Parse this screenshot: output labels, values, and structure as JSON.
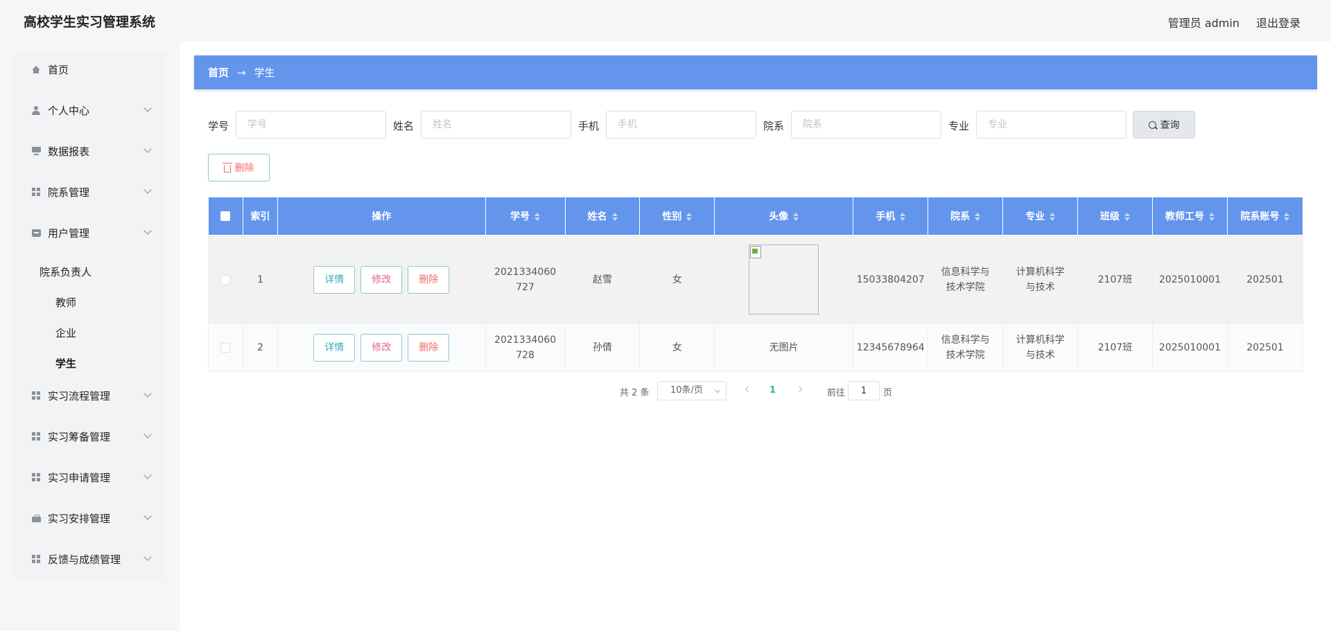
{
  "header": {
    "app_title": "高校学生实习管理系统",
    "user_label": "管理员 admin",
    "logout_label": "退出登录"
  },
  "sidebar": {
    "items": [
      {
        "label": "首页",
        "icon": "home-icon"
      },
      {
        "label": "个人中心",
        "icon": "user-icon"
      },
      {
        "label": "数据报表",
        "icon": "monitor-icon"
      },
      {
        "label": "院系管理",
        "icon": "grid-icon"
      },
      {
        "label": "用户管理",
        "icon": "chat-icon"
      },
      {
        "label": "实习流程管理",
        "icon": "grid-icon"
      },
      {
        "label": "实习筹备管理",
        "icon": "grid-icon"
      },
      {
        "label": "实习申请管理",
        "icon": "grid-icon"
      },
      {
        "label": "实习安排管理",
        "icon": "briefcase-icon"
      },
      {
        "label": "反馈与成绩管理",
        "icon": "grid-icon"
      }
    ],
    "user_mgmt_sub": [
      "院系负责人",
      "教师",
      "企业",
      "学生"
    ],
    "active_sub": "学生"
  },
  "breadcrumb": {
    "home": "首页",
    "arrow": "→",
    "current": "学生"
  },
  "search": {
    "fields": [
      {
        "label": "学号",
        "placeholder": "学号"
      },
      {
        "label": "姓名",
        "placeholder": "姓名"
      },
      {
        "label": "手机",
        "placeholder": "手机"
      },
      {
        "label": "院系",
        "placeholder": "院系"
      },
      {
        "label": "专业",
        "placeholder": "专业"
      }
    ],
    "query_label": "查询",
    "delete_label": "删除"
  },
  "table": {
    "headers": [
      "索引",
      "操作",
      "学号",
      "姓名",
      "性别",
      "头像",
      "手机",
      "院系",
      "专业",
      "班级",
      "教师工号",
      "院系账号"
    ],
    "actions": {
      "detail": "详情",
      "edit": "修改",
      "delete": "删除"
    },
    "rows": [
      {
        "index": "1",
        "student_id": "2021334060727",
        "name": "赵雪",
        "gender": "女",
        "avatar": "",
        "phone": "15033804207",
        "department": "信息科学与技术学院",
        "major": "计算机科学与技术",
        "class": "2107班",
        "teacher_id": "2025010001",
        "dept_account": "202501"
      },
      {
        "index": "2",
        "student_id": "2021334060728",
        "name": "孙倩",
        "gender": "女",
        "avatar": "无图片",
        "phone": "12345678964",
        "department": "信息科学与技术学院",
        "major": "计算机科学与技术",
        "class": "2107班",
        "teacher_id": "2025010001",
        "dept_account": "202501"
      }
    ]
  },
  "pagination": {
    "total": "共 2 条",
    "page_size": "10条/页",
    "current_page": "1",
    "goto_label": "前往",
    "goto_value": "1",
    "page_suffix": "页"
  },
  "colors": {
    "primary": "#6495ed",
    "accent": "#2bb3a3",
    "danger": "#f26a6a"
  }
}
